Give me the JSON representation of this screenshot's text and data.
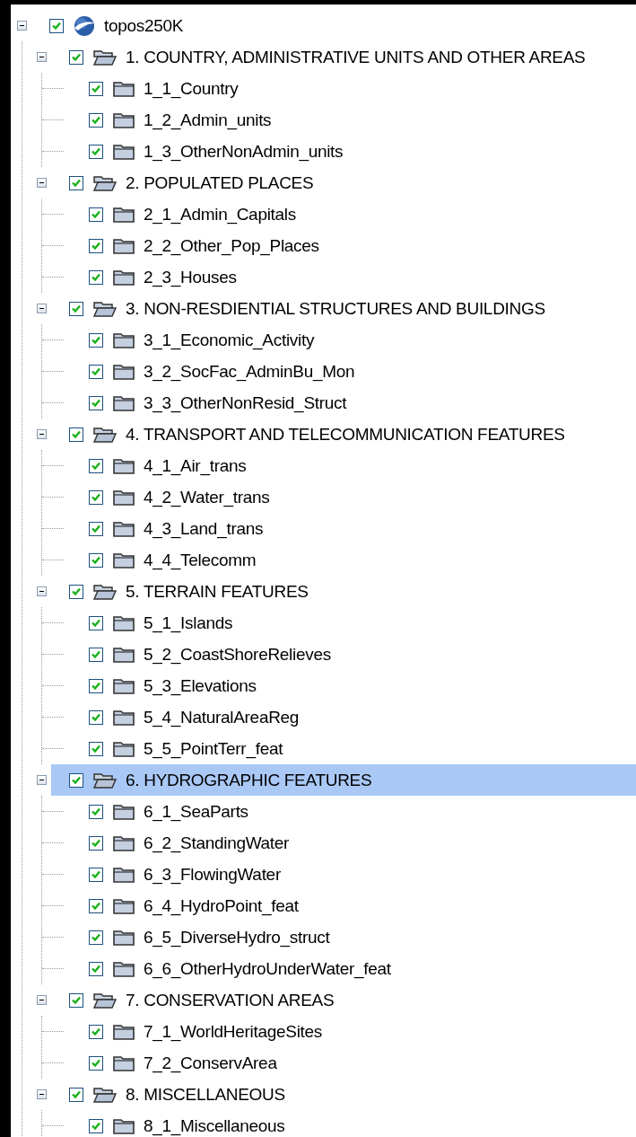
{
  "tree": {
    "label": "topos250K",
    "kind": "map",
    "checked": true,
    "expanded": true,
    "selected": false,
    "children": [
      {
        "label": "1. COUNTRY, ADMINISTRATIVE UNITS AND OTHER AREAS",
        "kind": "group",
        "checked": true,
        "expanded": true,
        "selected": false,
        "children": [
          {
            "label": "1_1_Country",
            "kind": "layer",
            "checked": true,
            "selected": false
          },
          {
            "label": "1_2_Admin_units",
            "kind": "layer",
            "checked": true,
            "selected": false
          },
          {
            "label": "1_3_OtherNonAdmin_units",
            "kind": "layer",
            "checked": true,
            "selected": false
          }
        ]
      },
      {
        "label": "2. POPULATED PLACES",
        "kind": "group",
        "checked": true,
        "expanded": true,
        "selected": false,
        "children": [
          {
            "label": "2_1_Admin_Capitals",
            "kind": "layer",
            "checked": true,
            "selected": false
          },
          {
            "label": "2_2_Other_Pop_Places",
            "kind": "layer",
            "checked": true,
            "selected": false
          },
          {
            "label": "2_3_Houses",
            "kind": "layer",
            "checked": true,
            "selected": false
          }
        ]
      },
      {
        "label": "3. NON-RESDIENTIAL STRUCTURES AND BUILDINGS",
        "kind": "group",
        "checked": true,
        "expanded": true,
        "selected": false,
        "children": [
          {
            "label": "3_1_Economic_Activity",
            "kind": "layer",
            "checked": true,
            "selected": false
          },
          {
            "label": "3_2_SocFac_AdminBu_Mon",
            "kind": "layer",
            "checked": true,
            "selected": false
          },
          {
            "label": "3_3_OtherNonResid_Struct",
            "kind": "layer",
            "checked": true,
            "selected": false
          }
        ]
      },
      {
        "label": "4. TRANSPORT AND TELECOMMUNICATION FEATURES",
        "kind": "group",
        "checked": true,
        "expanded": true,
        "selected": false,
        "children": [
          {
            "label": "4_1_Air_trans",
            "kind": "layer",
            "checked": true,
            "selected": false
          },
          {
            "label": "4_2_Water_trans",
            "kind": "layer",
            "checked": true,
            "selected": false
          },
          {
            "label": "4_3_Land_trans",
            "kind": "layer",
            "checked": true,
            "selected": false
          },
          {
            "label": "4_4_Telecomm",
            "kind": "layer",
            "checked": true,
            "selected": false
          }
        ]
      },
      {
        "label": "5. TERRAIN FEATURES",
        "kind": "group",
        "checked": true,
        "expanded": true,
        "selected": false,
        "children": [
          {
            "label": "5_1_Islands",
            "kind": "layer",
            "checked": true,
            "selected": false
          },
          {
            "label": "5_2_CoastShoreRelieves",
            "kind": "layer",
            "checked": true,
            "selected": false
          },
          {
            "label": "5_3_Elevations",
            "kind": "layer",
            "checked": true,
            "selected": false
          },
          {
            "label": "5_4_NaturalAreaReg",
            "kind": "layer",
            "checked": true,
            "selected": false
          },
          {
            "label": "5_5_PointTerr_feat",
            "kind": "layer",
            "checked": true,
            "selected": false
          }
        ]
      },
      {
        "label": "6. HYDROGRAPHIC FEATURES",
        "kind": "group",
        "checked": true,
        "expanded": true,
        "selected": true,
        "children": [
          {
            "label": "6_1_SeaParts",
            "kind": "layer",
            "checked": true,
            "selected": false
          },
          {
            "label": "6_2_StandingWater",
            "kind": "layer",
            "checked": true,
            "selected": false
          },
          {
            "label": "6_3_FlowingWater",
            "kind": "layer",
            "checked": true,
            "selected": false
          },
          {
            "label": "6_4_HydroPoint_feat",
            "kind": "layer",
            "checked": true,
            "selected": false
          },
          {
            "label": "6_5_DiverseHydro_struct",
            "kind": "layer",
            "checked": true,
            "selected": false
          },
          {
            "label": "6_6_OtherHydroUnderWater_feat",
            "kind": "layer",
            "checked": true,
            "selected": false
          }
        ]
      },
      {
        "label": "7. CONSERVATION AREAS",
        "kind": "group",
        "checked": true,
        "expanded": true,
        "selected": false,
        "children": [
          {
            "label": "7_1_WorldHeritageSites",
            "kind": "layer",
            "checked": true,
            "selected": false
          },
          {
            "label": "7_2_ConservArea",
            "kind": "layer",
            "checked": true,
            "selected": false
          }
        ]
      },
      {
        "label": "8. MISCELLANEOUS",
        "kind": "group",
        "checked": true,
        "expanded": true,
        "selected": false,
        "children": [
          {
            "label": "8_1_Miscellaneous",
            "kind": "layer",
            "checked": true,
            "selected": false
          }
        ]
      }
    ]
  }
}
